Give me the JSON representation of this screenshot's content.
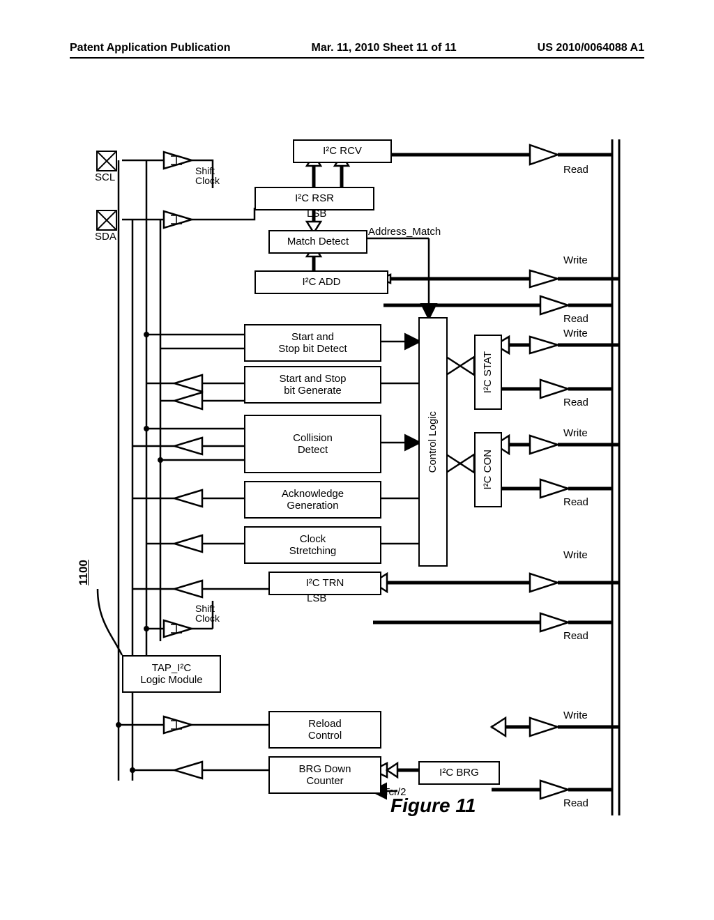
{
  "header": {
    "left": "Patent Application Publication",
    "center": "Mar. 11, 2010  Sheet 11 of 11",
    "right": "US 2010/0064088 A1"
  },
  "pins": {
    "scl": "SCL",
    "sda": "SDA"
  },
  "ref": "1100",
  "blocks": {
    "i2c_rcv": "I²C RCV",
    "i2c_rsr": "I²C RSR",
    "match_detect": "Match Detect",
    "i2c_add": "I²C ADD",
    "start_stop_detect": "Start and\nStop bit Detect",
    "start_stop_gen": "Start and Stop\nbit Generate",
    "collision_detect": "Collision\nDetect",
    "ack_gen": "Acknowledge\nGeneration",
    "clock_stretch": "Clock\nStretching",
    "i2c_trn": "I²C TRN",
    "tap_module": "TAP_I²C\nLogic Module",
    "reload_ctrl": "Reload\nControl",
    "brg_down": "BRG Down\nCounter",
    "i2c_brg": "I²C BRG",
    "control_logic": "Control Logic",
    "i2c_stat": "I²C STAT",
    "i2c_con": "I²C CON"
  },
  "labels": {
    "shift_clock": "Shift\nClock",
    "shift_clock2": "Shift\nClock",
    "lsb": "LSB",
    "lsb2": "LSB",
    "address_match": "Address_Match",
    "read": "Read",
    "write": "Write",
    "tcr2": "Tcr/2"
  },
  "figure_title": "Figure 11"
}
